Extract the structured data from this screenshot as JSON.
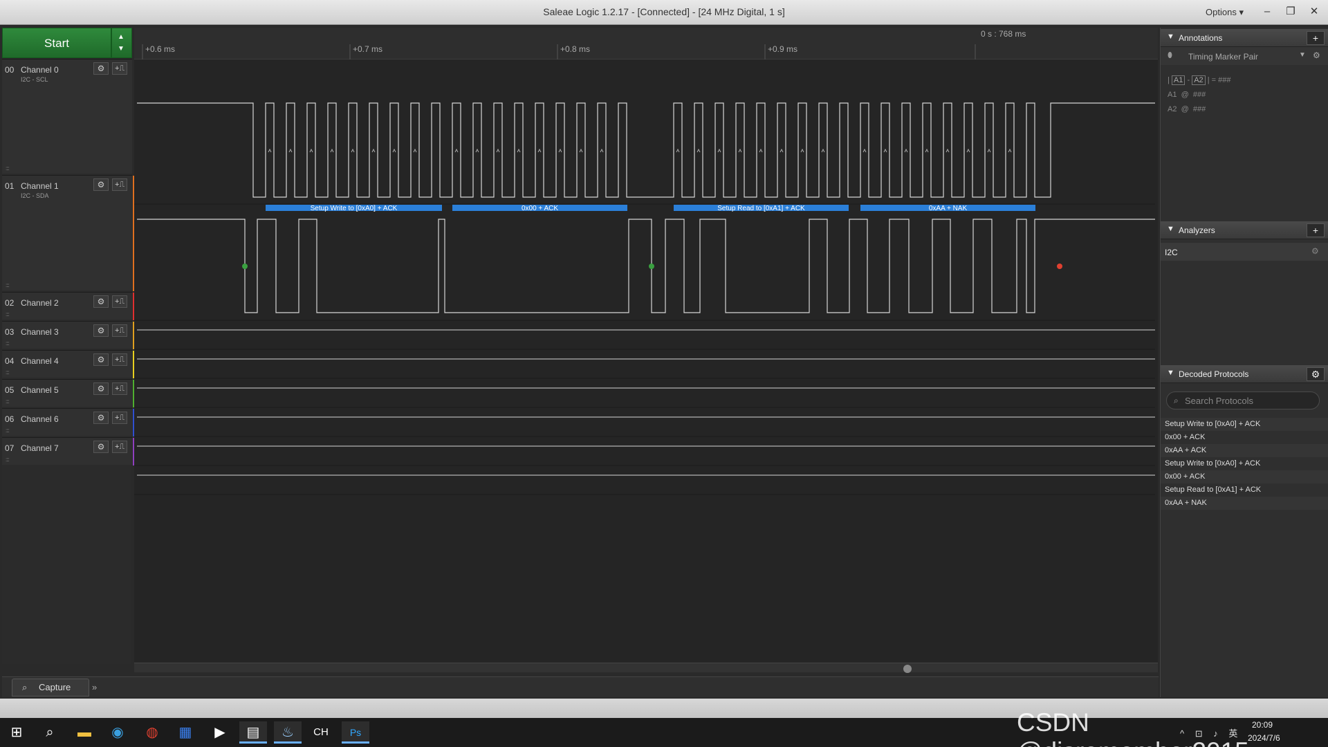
{
  "window": {
    "title": "Saleae Logic 1.2.17 - [Connected] - [24 MHz Digital, 1 s]",
    "options_label": "Options ▾",
    "minimize": "–",
    "restore": "❐",
    "close": "✕"
  },
  "capture": {
    "start_label": "Start",
    "tab_label": "Capture",
    "more_label": "»"
  },
  "ruler": {
    "ticks": [
      "+0.6 ms",
      "+0.7 ms",
      "+0.8 ms",
      "+0.9 ms"
    ],
    "marker": "0 s : 768 ms"
  },
  "channels": [
    {
      "num": "00",
      "name": "Channel 0",
      "sub": "I2C - SCL",
      "color": "#2a2a2a"
    },
    {
      "num": "01",
      "name": "Channel 1",
      "sub": "I2C - SDA",
      "color": "#e07020"
    },
    {
      "num": "02",
      "name": "Channel 2",
      "sub": "",
      "color": "#e03030"
    },
    {
      "num": "03",
      "name": "Channel 3",
      "sub": "",
      "color": "#e0a020"
    },
    {
      "num": "04",
      "name": "Channel 4",
      "sub": "",
      "color": "#e8d020"
    },
    {
      "num": "05",
      "name": "Channel 5",
      "sub": "",
      "color": "#50b030"
    },
    {
      "num": "06",
      "name": "Channel 6",
      "sub": "",
      "color": "#3050d0"
    },
    {
      "num": "07",
      "name": "Channel 7",
      "sub": "",
      "color": "#9040c0"
    }
  ],
  "decoded_frames": [
    "Setup Write to [0xA0] + ACK",
    "0x00 + ACK",
    "Setup Read to [0xA1] + ACK",
    "0xAA + NAK"
  ],
  "annotations": {
    "title": "Annotations",
    "add": "+",
    "timing_pair": "Timing Marker Pair",
    "formula_a1": "A1",
    "formula_a2": "A2",
    "formula_dash": "-",
    "formula_bar": "|",
    "formula_result": "= ###",
    "a1_label": "A1",
    "a2_label": "A2",
    "at": "@",
    "a1_value": "###",
    "a2_value": "###"
  },
  "analyzers": {
    "title": "Analyzers",
    "add": "+",
    "items": [
      "I2C"
    ]
  },
  "decoded_protocols": {
    "title": "Decoded Protocols",
    "search_placeholder": "Search Protocols",
    "items": [
      "Setup Write to [0xA0] + ACK",
      "0x00 + ACK",
      "0xAA + ACK",
      "Setup Write to [0xA0] + ACK",
      "0x00 + ACK",
      "Setup Read to [0xA1] + ACK",
      "0xAA + NAK"
    ]
  },
  "taskbar": {
    "time": "20:09",
    "date": "2024/7/6",
    "ime": "英"
  },
  "watermark": "CSDN @disremember2015"
}
